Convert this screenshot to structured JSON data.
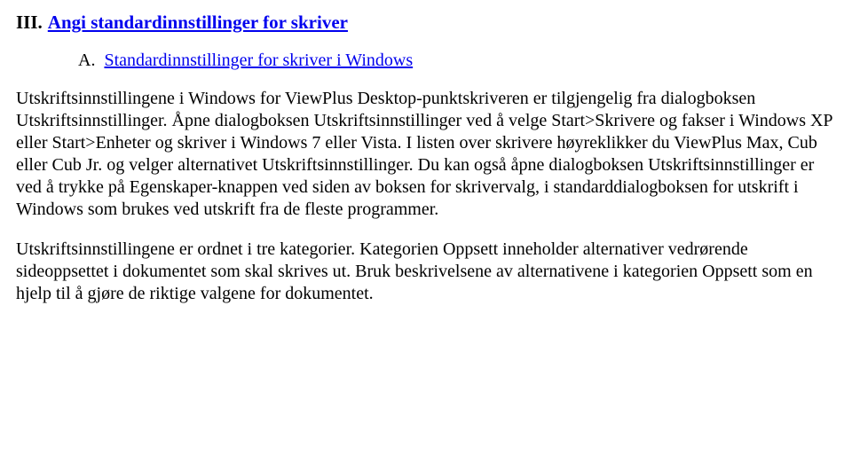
{
  "heading": {
    "prefix": "III.",
    "title": "Angi standardinnstillinger for skriver"
  },
  "subheading": {
    "prefix": "A.",
    "title": "Standardinnstillinger for skriver i Windows"
  },
  "paragraphs": {
    "p1": "Utskriftsinnstillingene i Windows for ViewPlus Desktop-punktskriveren er tilgjengelig fra dialogboksen Utskriftsinnstillinger. Åpne dialogboksen Utskriftsinnstillinger ved å velge Start>Skrivere og fakser i Windows XP eller Start>Enheter og skriver i Windows 7 eller Vista. I listen over skrivere høyreklikker du ViewPlus Max, Cub eller Cub Jr. og velger alternativet Utskriftsinnstillinger. Du kan også åpne dialogboksen Utskriftsinnstillinger er ved å trykke på Egenskaper-knappen ved siden av boksen for skrivervalg, i standarddialogboksen for utskrift i Windows som brukes ved utskrift fra de fleste programmer.",
    "p2": "Utskriftsinnstillingene er ordnet i tre kategorier. Kategorien Oppsett inneholder alternativer vedrørende sideoppsettet i dokumentet som skal skrives ut. Bruk beskrivelsene av alternativene i kategorien Oppsett som en hjelp til å gjøre de riktige valgene for dokumentet."
  }
}
